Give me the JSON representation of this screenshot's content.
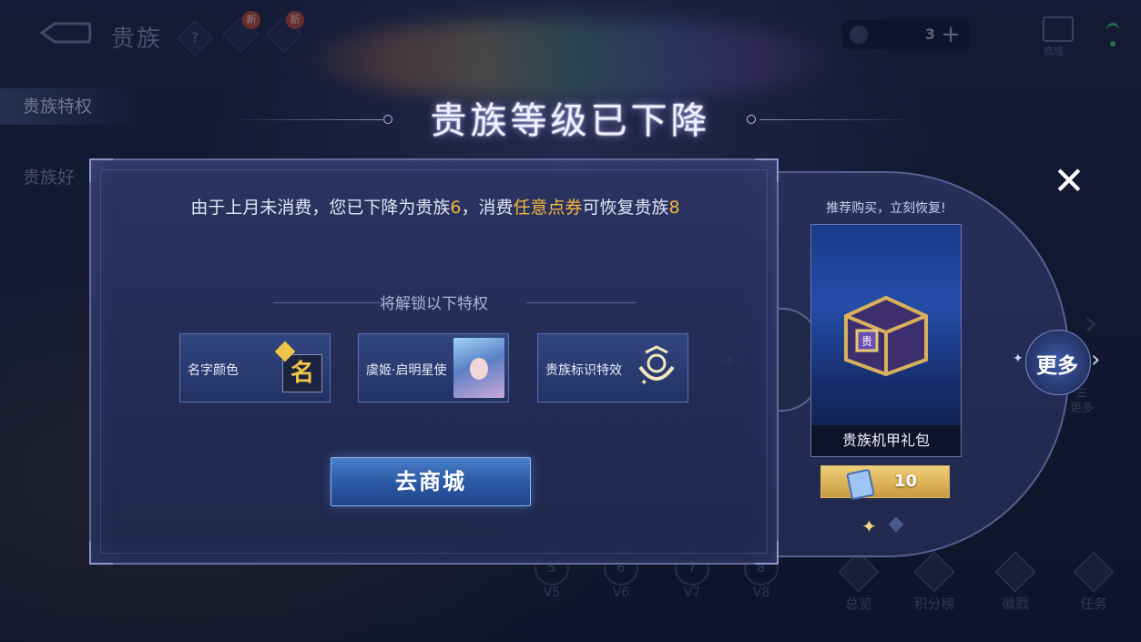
{
  "header": {
    "title": "贵族",
    "help_symbol": "?",
    "new_badge": "新",
    "currency_count": "3",
    "plus_symbol": "+",
    "shop_label": "商城"
  },
  "sidebar": {
    "items": [
      {
        "label": "贵族特权",
        "active": true
      },
      {
        "label": "贵族好"
      }
    ]
  },
  "bottom": {
    "levels": [
      {
        "num": "5",
        "label": "V5"
      },
      {
        "num": "6",
        "label": "V6"
      },
      {
        "num": "7",
        "label": "V7"
      },
      {
        "num": "8",
        "label": "V8"
      }
    ],
    "nav": [
      {
        "label": "总览"
      },
      {
        "label": "积分榜"
      },
      {
        "label": "徽戮"
      },
      {
        "label": "任务"
      }
    ],
    "side_more": "更多"
  },
  "dialog": {
    "title": "贵族等级已下降",
    "message_part1": "由于上月未消费，您已下降为贵族",
    "message_level_from": "6",
    "message_part2": "，消费",
    "message_highlight": "任意点券",
    "message_part3": "可恢复贵族",
    "message_level_to": "8",
    "unlock_heading": "将解锁以下特权",
    "privileges": [
      {
        "label": "名字颜色",
        "icon": "name-color-icon",
        "icon_text": "名"
      },
      {
        "label": "虞姬·启明星使",
        "icon": "hero-skin-portrait"
      },
      {
        "label": "贵族标识特效",
        "icon": "noble-emblem-icon"
      }
    ],
    "go_button": "去商城",
    "close_symbol": "✕"
  },
  "recommend": {
    "title": "推荐购买，立刻恢复!",
    "item_name": "贵族机甲礼包",
    "price": "10",
    "price_icon": "coupon-icon",
    "more_button": "更多",
    "more_arrow": "›"
  },
  "colors": {
    "gold": "#f5b63c",
    "button_blue": "#2d5aa6",
    "price_gold": "#e0b85a"
  }
}
